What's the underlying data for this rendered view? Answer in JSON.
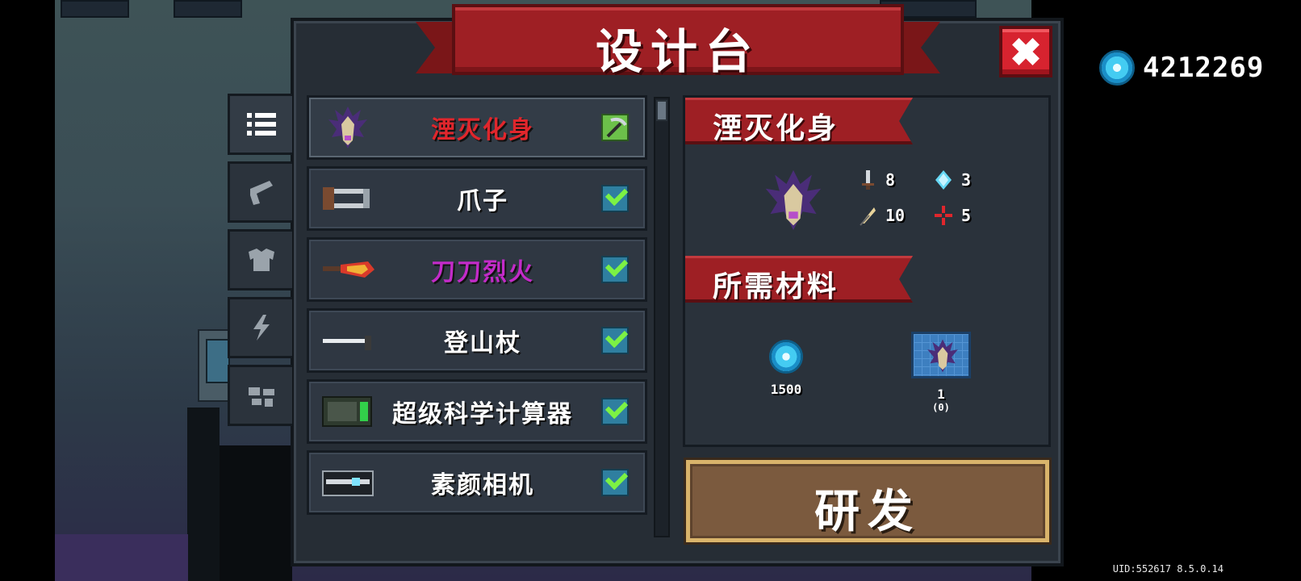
{
  "currency": {
    "icon": "gem-icon",
    "value": "4212269"
  },
  "panel": {
    "title": "设计台",
    "close_icon": "close-icon"
  },
  "tabs": [
    {
      "icon": "list-icon",
      "active": true
    },
    {
      "icon": "gun-icon",
      "active": false
    },
    {
      "icon": "armor-icon",
      "active": false
    },
    {
      "icon": "lightning-icon",
      "active": false
    },
    {
      "icon": "gear-pieces-icon",
      "active": false
    }
  ],
  "items": [
    {
      "name": "湮灭化身",
      "color": "red",
      "icon": "mask-icon",
      "status": "pickaxe-icon",
      "selected": true
    },
    {
      "name": "爪子",
      "color": "white",
      "icon": "claw-icon",
      "status": "check-icon"
    },
    {
      "name": "刀刀烈火",
      "color": "purple",
      "icon": "flame-blade-icon",
      "status": "check-icon"
    },
    {
      "name": "登山杖",
      "color": "white",
      "icon": "cane-icon",
      "status": "check-icon"
    },
    {
      "name": "超级科学计算器",
      "color": "white",
      "icon": "calculator-icon",
      "status": "check-icon"
    },
    {
      "name": "素颜相机",
      "color": "white",
      "icon": "camera-icon",
      "status": "check-icon"
    }
  ],
  "detail": {
    "name": "湮灭化身",
    "stats": [
      {
        "icon": "sword-icon",
        "value": "8"
      },
      {
        "icon": "crystal-icon",
        "value": "3"
      },
      {
        "icon": "feather-icon",
        "value": "10"
      },
      {
        "icon": "crosshair-icon",
        "value": "5"
      }
    ],
    "materials_title": "所需材料",
    "materials": [
      {
        "icon": "gem-icon",
        "label": "1500",
        "sub": ""
      },
      {
        "icon": "blueprint-icon",
        "label": "1",
        "sub": "(0)"
      }
    ]
  },
  "research_button": "研发",
  "uid": "UID:552617 8.5.0.14",
  "colors": {
    "banner": "#9e1f24",
    "close": "#d7232f",
    "button": "#7b5a3e",
    "check": "#7cf244"
  }
}
